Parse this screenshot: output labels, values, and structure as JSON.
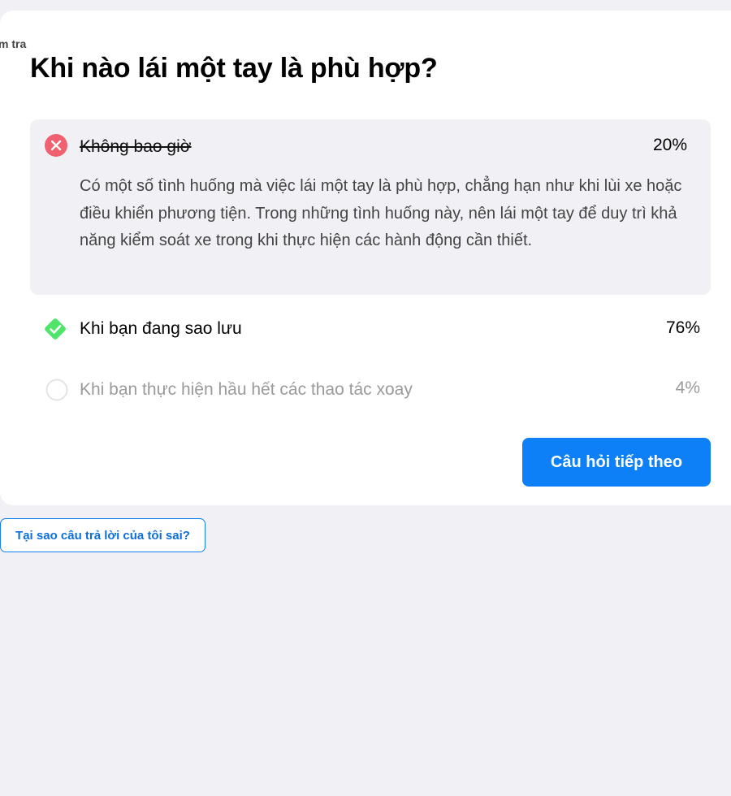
{
  "breadcrumb": "m tra",
  "question": "Khi nào lái một tay là phù hợp?",
  "options": [
    {
      "label": "Không bao giờ",
      "percent": "20%",
      "status": "wrong",
      "explanation": "Có một số tình huống mà việc lái một tay là phù hợp, chẳng hạn như khi lùi xe hoặc điều khiển phương tiện. Trong những tình huống này, nên lái một tay để duy trì khả năng kiểm soát xe trong khi thực hiện các hành động cần thiết."
    },
    {
      "label": "Khi bạn đang sao lưu",
      "percent": "76%",
      "status": "correct"
    },
    {
      "label": "Khi bạn thực hiện hầu hết các thao tác xoay",
      "percent": "4%",
      "status": "unselected"
    }
  ],
  "next_button": "Câu hỏi tiếp theo",
  "why_wrong_button": "Tại sao câu trả lời của tôi sai?",
  "colors": {
    "wrong": "#f0606f",
    "correct": "#4ee56a",
    "primary": "#0d7ff7",
    "background": "#f0f0f5"
  },
  "icons": {
    "wrong": "x-circle-icon",
    "correct": "check-diamond-icon",
    "unselected": "empty-radio-icon"
  }
}
